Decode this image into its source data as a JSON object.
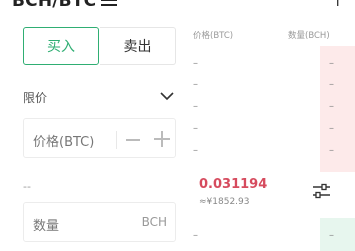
{
  "header": {
    "pair": "BCH/BTC",
    "menu_icon": "menu-icon",
    "change_color": "#f2c7cd"
  },
  "order_panel": {
    "tabs": [
      {
        "label": "买入",
        "active": true
      },
      {
        "label": "卖出",
        "active": false
      }
    ],
    "order_type": "限价",
    "price_placeholder": "价格(BTC)",
    "available": "--",
    "quantity_placeholder": "数量",
    "quantity_unit": "BCH"
  },
  "order_book": {
    "price_header": "价格(BTC)",
    "qty_header": "数量(BCH)",
    "empty_value": "–",
    "last_price": "0.031194",
    "last_price_fiat": "≈¥1852.93",
    "colors": {
      "buy": "#2fae73",
      "sell": "#d64b5e"
    }
  }
}
